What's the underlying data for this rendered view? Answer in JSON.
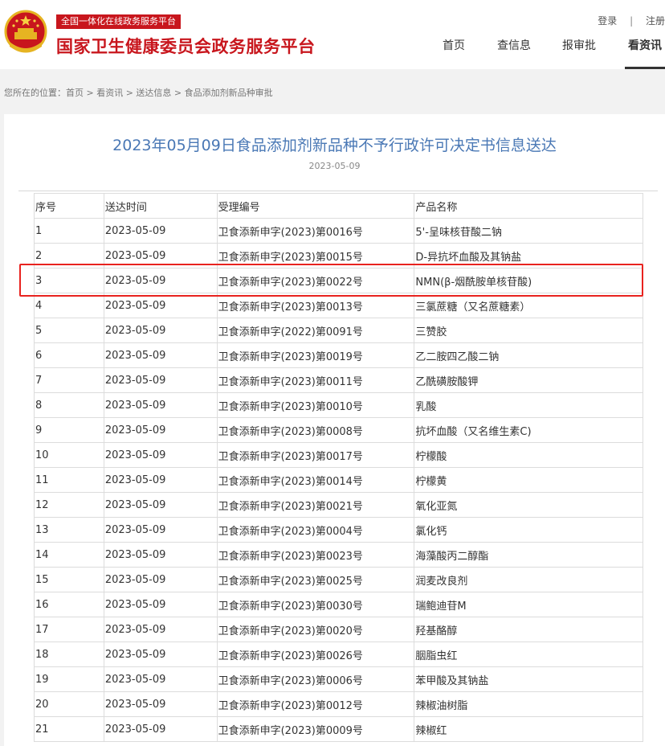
{
  "header": {
    "platform_tag": "全国一体化在线政务服务平台",
    "site_title": "国家卫生健康委员会政务服务平台",
    "login": "登录",
    "separator": "|",
    "register": "注册"
  },
  "nav": [
    {
      "label": "首页"
    },
    {
      "label": "查信息"
    },
    {
      "label": "报审批"
    },
    {
      "label": "看资讯"
    }
  ],
  "breadcrumb": "您所在的位置：首页 > 看资讯 > 送达信息 > 食品添加剂新品种审批",
  "article": {
    "title": "2023年05月09日食品添加剂新品种不予行政许可决定书信息送达",
    "date": "2023-05-09"
  },
  "table": {
    "headers": [
      "序号",
      "送达时间",
      "受理编号",
      "产品名称"
    ],
    "rows": [
      [
        "1",
        "2023-05-09",
        "卫食添新申字(2023)第0016号",
        "5'-呈味核苷酸二钠"
      ],
      [
        "2",
        "2023-05-09",
        "卫食添新申字(2023)第0015号",
        "D-异抗坏血酸及其钠盐"
      ],
      [
        "3",
        "2023-05-09",
        "卫食添新申字(2023)第0022号",
        "NMN(β-烟酰胺单核苷酸)"
      ],
      [
        "4",
        "2023-05-09",
        "卫食添新申字(2023)第0013号",
        "三氯蔗糖（又名蔗糖素）"
      ],
      [
        "5",
        "2023-05-09",
        "卫食添新申字(2022)第0091号",
        "三赞胶"
      ],
      [
        "6",
        "2023-05-09",
        "卫食添新申字(2023)第0019号",
        "乙二胺四乙酸二钠"
      ],
      [
        "7",
        "2023-05-09",
        "卫食添新申字(2023)第0011号",
        "乙酰磺胺酸钾"
      ],
      [
        "8",
        "2023-05-09",
        "卫食添新申字(2023)第0010号",
        "乳酸"
      ],
      [
        "9",
        "2023-05-09",
        "卫食添新申字(2023)第0008号",
        "抗坏血酸（又名维生素C)"
      ],
      [
        "10",
        "2023-05-09",
        "卫食添新申字(2023)第0017号",
        "柠檬酸"
      ],
      [
        "11",
        "2023-05-09",
        "卫食添新申字(2023)第0014号",
        "柠檬黄"
      ],
      [
        "12",
        "2023-05-09",
        "卫食添新申字(2023)第0021号",
        "氧化亚氮"
      ],
      [
        "13",
        "2023-05-09",
        "卫食添新申字(2023)第0004号",
        "氯化钙"
      ],
      [
        "14",
        "2023-05-09",
        "卫食添新申字(2023)第0023号",
        "海藻酸丙二醇酯"
      ],
      [
        "15",
        "2023-05-09",
        "卫食添新申字(2023)第0025号",
        "润麦改良剂"
      ],
      [
        "16",
        "2023-05-09",
        "卫食添新申字(2023)第0030号",
        "瑞鲍迪苷M"
      ],
      [
        "17",
        "2023-05-09",
        "卫食添新申字(2023)第0020号",
        "羟基酪醇"
      ],
      [
        "18",
        "2023-05-09",
        "卫食添新申字(2023)第0026号",
        "胭脂虫红"
      ],
      [
        "19",
        "2023-05-09",
        "卫食添新申字(2023)第0006号",
        "苯甲酸及其钠盐"
      ],
      [
        "20",
        "2023-05-09",
        "卫食添新申字(2023)第0012号",
        "辣椒油树脂"
      ],
      [
        "21",
        "2023-05-09",
        "卫食添新申字(2023)第0009号",
        "辣椒红"
      ]
    ]
  },
  "colors": {
    "brand_red": "#c8161d",
    "title_blue": "#4a78b5",
    "highlight": "#e8231f"
  }
}
